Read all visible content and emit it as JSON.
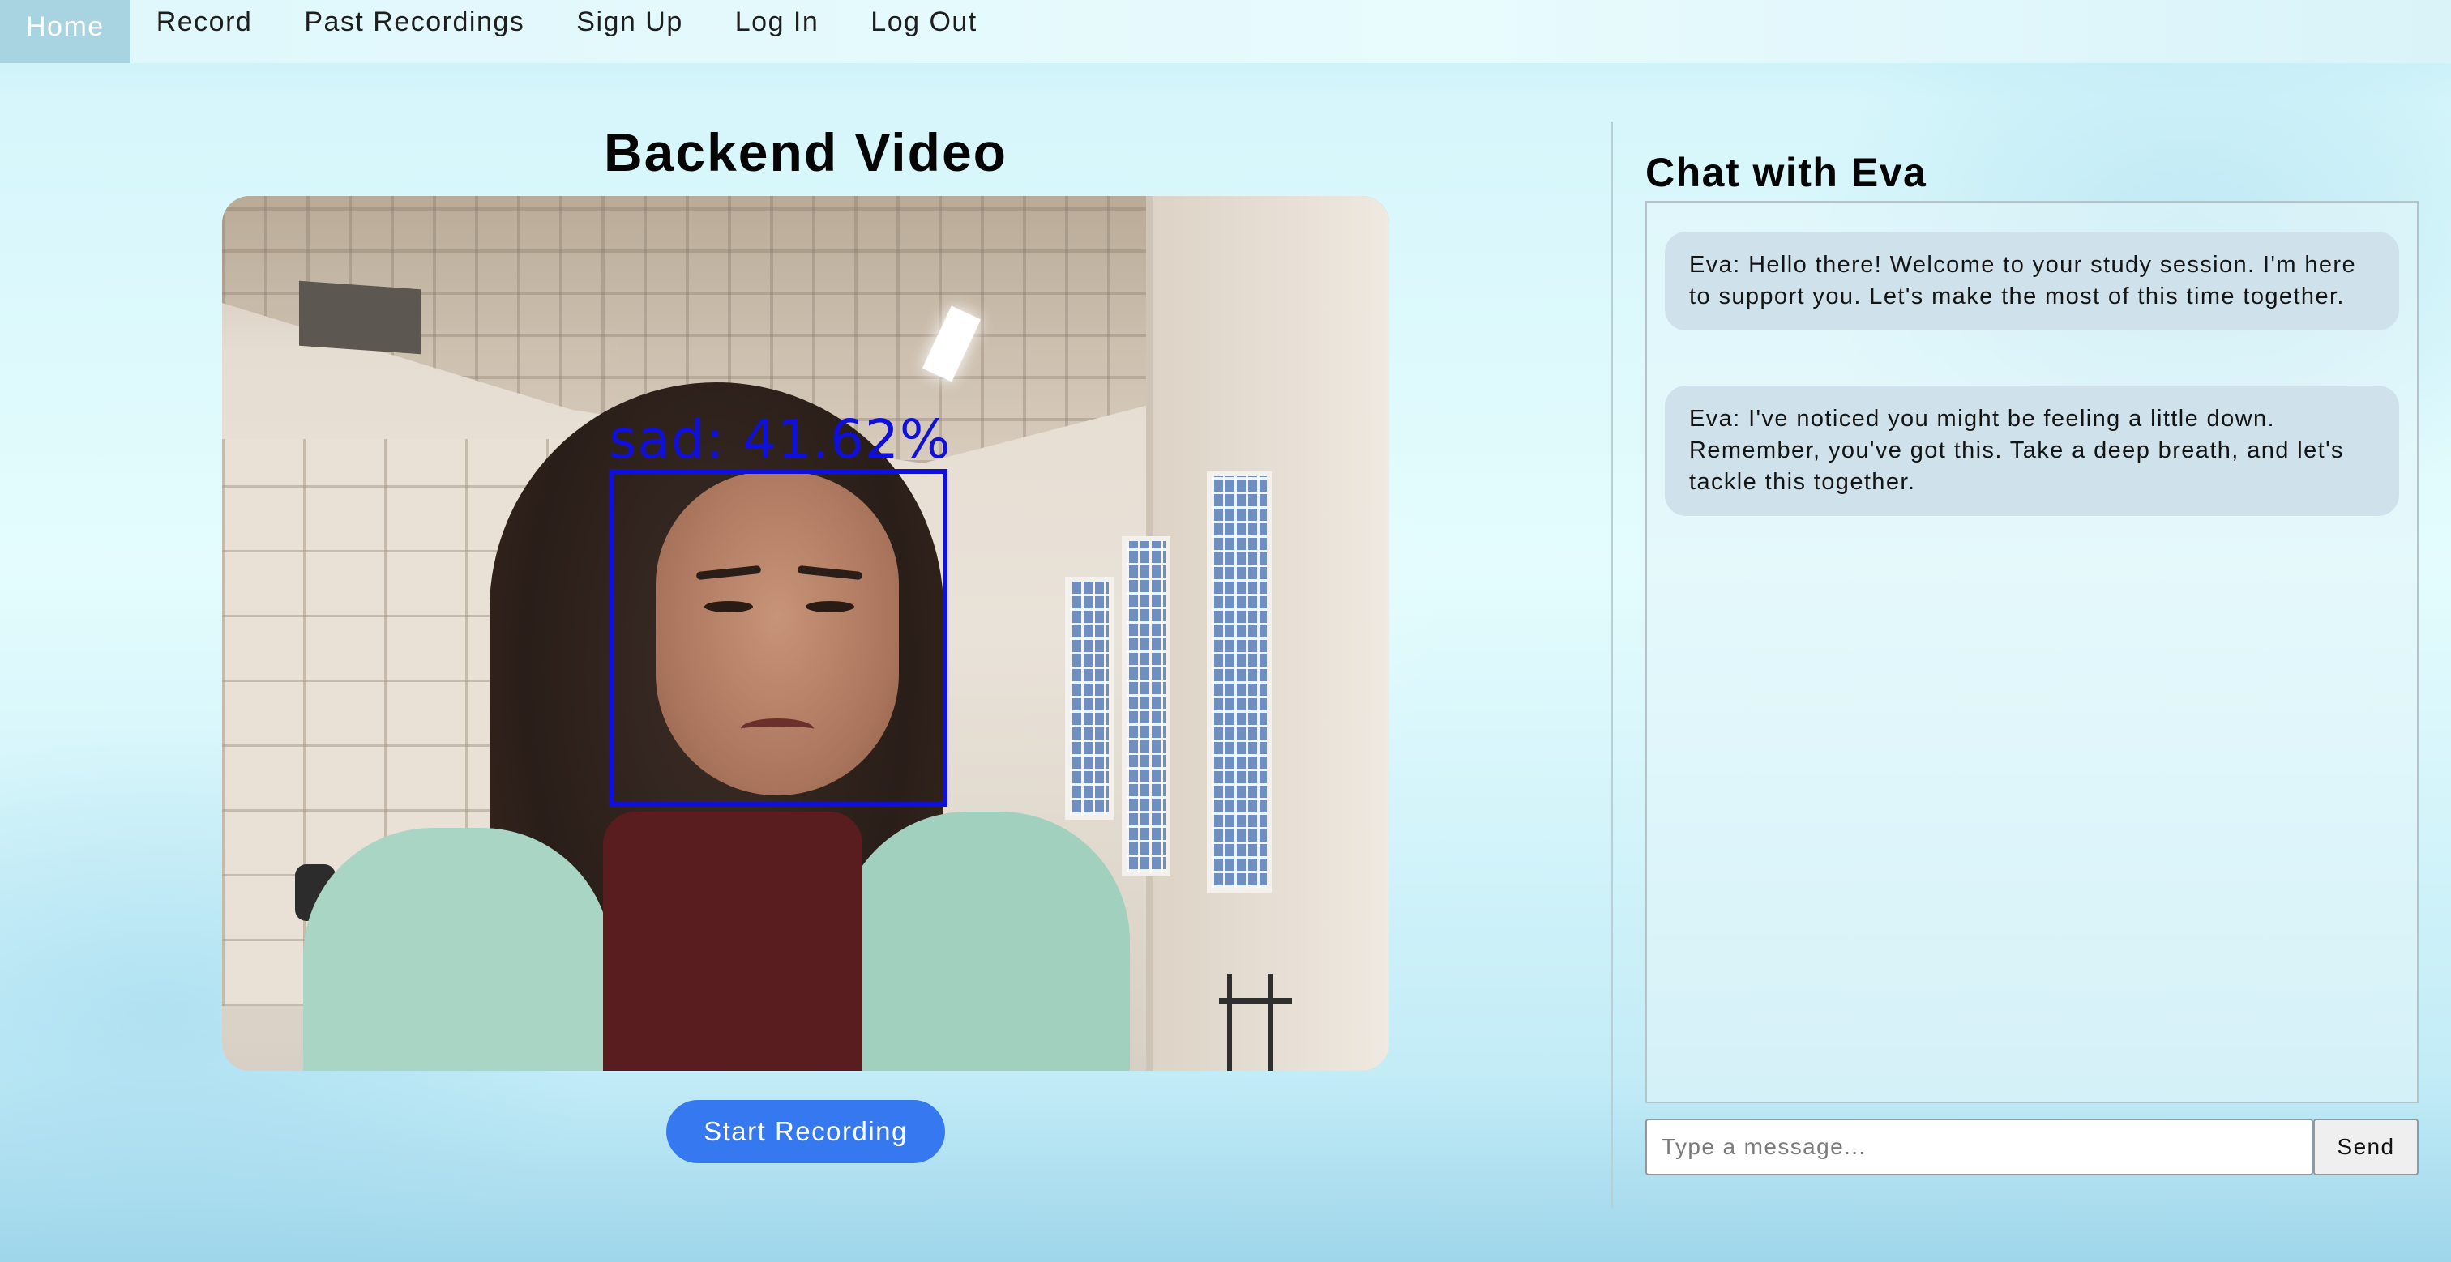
{
  "nav": {
    "items": [
      {
        "label": "Home",
        "active": true
      },
      {
        "label": "Record",
        "active": false
      },
      {
        "label": "Past Recordings",
        "active": false
      },
      {
        "label": "Sign Up",
        "active": false
      },
      {
        "label": "Log In",
        "active": false
      },
      {
        "label": "Log Out",
        "active": false
      }
    ]
  },
  "video": {
    "title": "Backend Video",
    "emotion_label": "sad: 41.62%",
    "start_button": "Start Recording"
  },
  "chat": {
    "title": "Chat with Eva",
    "messages": [
      {
        "text": "Eva: Hello there! Welcome to your study session. I'm here to support you. Let's make the most of this time together."
      },
      {
        "text": "Eva: I've noticed you might be feeling a little down. Remember, you've got this. Take a deep breath, and let's tackle this together."
      }
    ],
    "input_placeholder": "Type a message...",
    "send_label": "Send"
  },
  "colors": {
    "accent_button": "#3578f0",
    "nav_active": "#a8d3e0",
    "detection_box": "#1010d8",
    "chat_bubble": "#cfe2eb"
  }
}
